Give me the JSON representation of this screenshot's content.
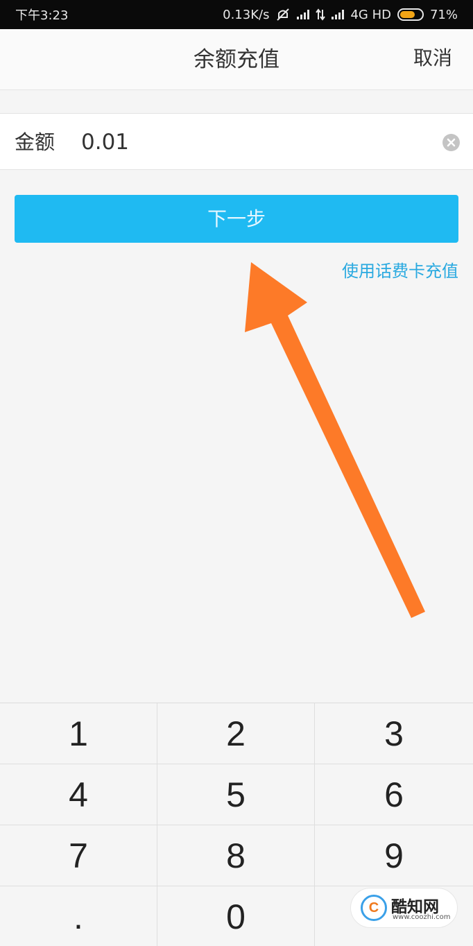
{
  "status_bar": {
    "time": "下午3:23",
    "net_speed": "0.13K/s",
    "network": "4G HD",
    "battery": "71%",
    "battery_level": 0.71,
    "battery_color": "#f2a516"
  },
  "header": {
    "title": "余额充值",
    "cancel_label": "取消"
  },
  "amount": {
    "label": "金额",
    "value": "0.01"
  },
  "actions": {
    "next_label": "下一步",
    "phone_card_link": "使用话费卡充值"
  },
  "keypad": {
    "keys": [
      "1",
      "2",
      "3",
      "4",
      "5",
      "6",
      "7",
      "8",
      "9",
      ".",
      "0",
      ""
    ]
  },
  "watermark": {
    "logo_letter": "C",
    "name": "酷知网",
    "url": "www.coozhi.com"
  },
  "colors": {
    "accent": "#1fbaf2",
    "link": "#29a9e0",
    "annotation_arrow": "#fd7a28"
  },
  "icons": {
    "clear": "clear-circle-icon",
    "mute": "mute-icon",
    "signal": "signal-bars-icon",
    "data": "data-arrows-icon",
    "battery": "battery-icon"
  }
}
